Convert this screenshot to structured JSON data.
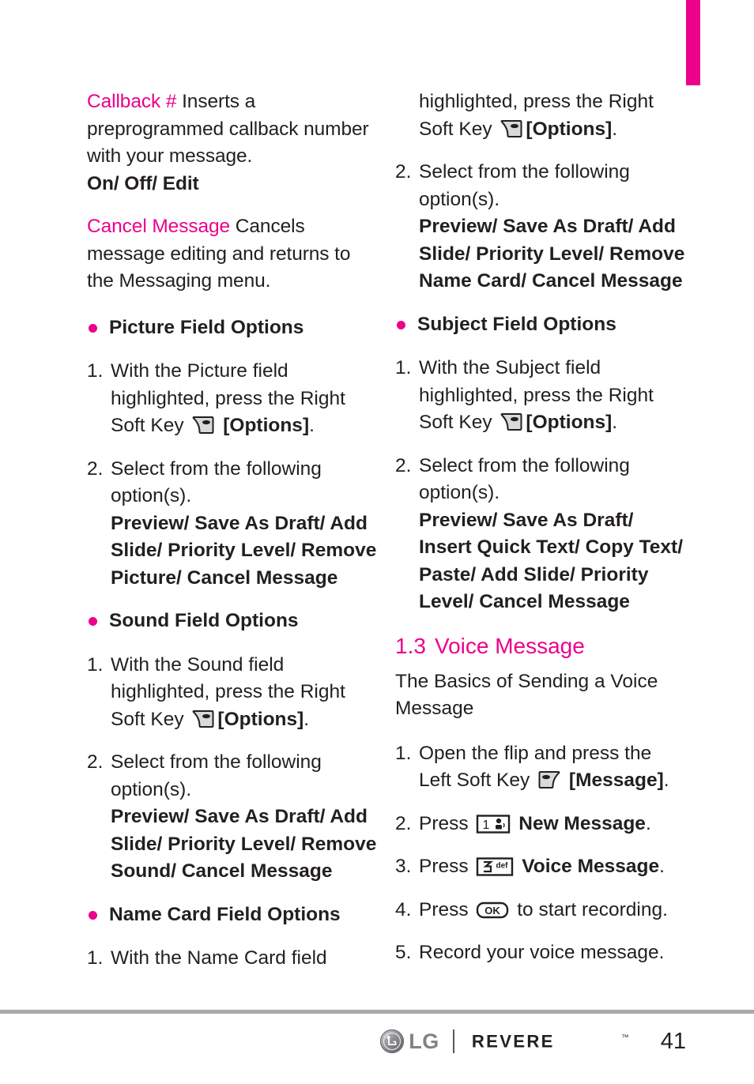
{
  "accent_color": "#ec008c",
  "tab_marker": {
    "color": "#ec008c"
  },
  "left_column": {
    "callback": {
      "term": "Callback #",
      "desc": "  Inserts a preprogrammed callback number with your message.",
      "options": "On/ Off/ Edit"
    },
    "cancel_message": {
      "term": "Cancel Message",
      "desc": "  Cancels message editing and returns to the Messaging menu."
    },
    "picture_field": {
      "heading": "Picture Field Options",
      "step1_num": "1.",
      "step1_a": "With the Picture field highlighted, press the Right Soft Key ",
      "step1_icon": "right-soft-key-icon",
      "step1_b": " [Options].",
      "step1_b_bold": "[Options]",
      "step2_num": "2.",
      "step2_text": "Select from the following option(s).",
      "step2_options": "Preview/ Save As Draft/ Add Slide/ Priority Level/ Remove Picture/ Cancel Message"
    },
    "sound_field": {
      "heading": "Sound Field Options",
      "step1_num": "1.",
      "step1_a": "With the Sound field highlighted, press the Right Soft Key ",
      "step1_b_bold": "[Options]",
      "step2_num": "2.",
      "step2_text": "Select from the following option(s).",
      "step2_options": "Preview/ Save As Draft/ Add Slide/ Priority Level/ Remove Sound/ Cancel Message"
    },
    "name_card_field": {
      "heading": "Name Card Field Options",
      "step1_num": "1.",
      "step1_a": "With the Name Card field"
    }
  },
  "right_column": {
    "name_card_cont": {
      "step1_a": "highlighted, press the Right Soft Key ",
      "step1_b_bold": "[Options]",
      "step2_num": "2.",
      "step2_text": "Select from the following option(s).",
      "step2_options": "Preview/ Save As Draft/ Add Slide/ Priority Level/ Remove Name Card/ Cancel Message"
    },
    "subject_field": {
      "heading": "Subject Field Options",
      "step1_num": "1.",
      "step1_a": "With the Subject field highlighted, press the Right Soft Key ",
      "step1_b_bold": "[Options]",
      "step2_num": "2.",
      "step2_text": "Select from the following option(s).",
      "step2_options": "Preview/ Save As Draft/ Insert Quick Text/ Copy Text/ Paste/ Add Slide/ Priority Level/ Cancel Message"
    },
    "voice_message": {
      "number": "1.3",
      "title": "Voice Message",
      "subtitle": "The Basics of Sending a Voice Message",
      "steps": [
        {
          "num": "1.",
          "before": "Open the flip and press the Left Soft Key ",
          "icon": "left-soft-key-icon",
          "bold": "[Message]",
          "after": "."
        },
        {
          "num": "2.",
          "before": "Press ",
          "icon": "key-1-voicemail-icon",
          "bold": "New Message",
          "after": "."
        },
        {
          "num": "3.",
          "before": "Press ",
          "icon": "key-3-def-icon",
          "bold": "Voice Message",
          "after": "."
        },
        {
          "num": "4.",
          "before": "Press ",
          "icon": "ok-key-icon",
          "bold": "",
          "after": " to start recording."
        },
        {
          "num": "5.",
          "before": "Record your voice message.",
          "icon": "",
          "bold": "",
          "after": ""
        }
      ],
      "key_labels": {
        "key1_digit": "1",
        "key3_digit": "3",
        "key3_letters": "def",
        "ok_label": "OK"
      }
    }
  },
  "footer": {
    "brand": "LG",
    "model": "REVERE",
    "trademark": "™",
    "page_number": "41"
  }
}
